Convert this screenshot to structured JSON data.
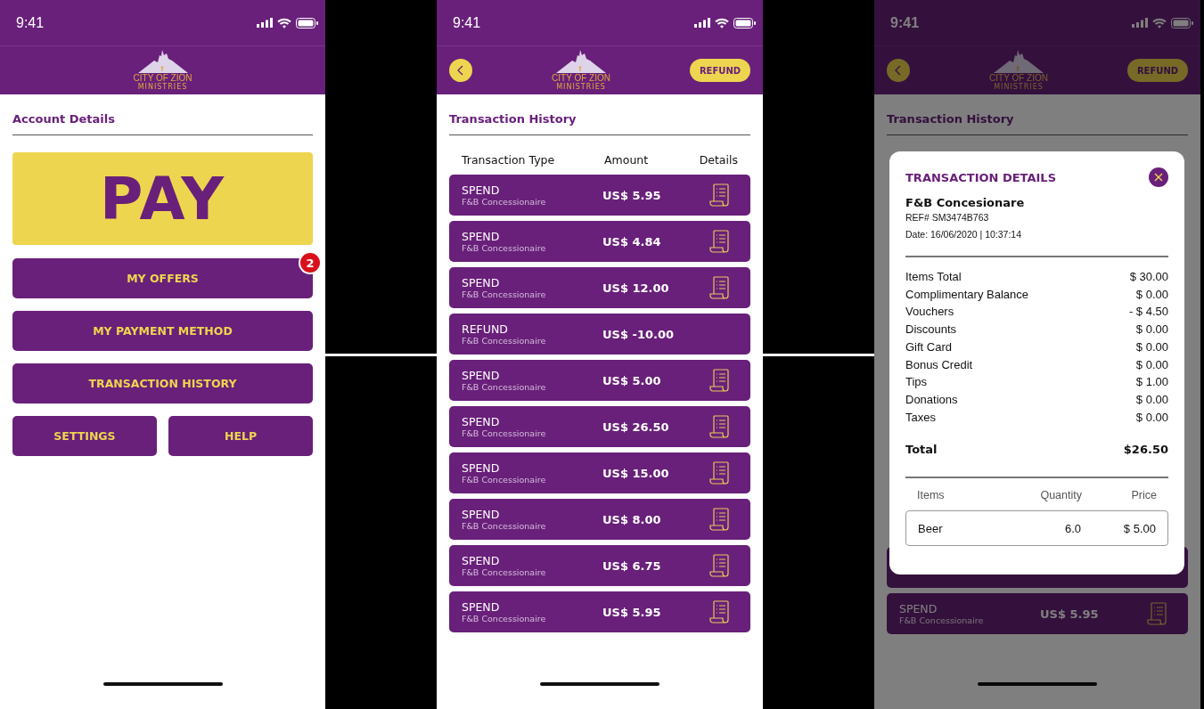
{
  "account_screen": {
    "time": "9:41",
    "logo": {
      "name": "CITY OF ZION",
      "subtitle": "MINISTRIES"
    },
    "title": "Account Details",
    "pay_button": "PAY",
    "buttons": [
      {
        "label": "MY OFFERS",
        "kind": "full",
        "badge": "2"
      },
      {
        "label": "MY PAYMENT METHOD",
        "kind": "full"
      },
      {
        "label": "TRANSACTION HISTORY",
        "kind": "full"
      },
      {
        "label": "SETTINGS",
        "kind": "half"
      },
      {
        "label": "HELP",
        "kind": "half"
      }
    ]
  },
  "history_screen": {
    "time": "9:41",
    "logo": {
      "name": "CITY OF ZION",
      "subtitle": "MINISTRIES"
    },
    "refund_button": "REFUND",
    "title": "Transaction History",
    "columns": [
      "Transaction Type",
      "Amount",
      "Details"
    ],
    "rows": [
      {
        "type": "SPEND",
        "merchant": "F&B Concessionaire",
        "amount": "US$ 5.95",
        "receipt": true
      },
      {
        "type": "SPEND",
        "merchant": "F&B Concessionaire",
        "amount": "US$ 4.84",
        "receipt": true
      },
      {
        "type": "SPEND",
        "merchant": "F&B Concessionaire",
        "amount": "US$ 12.00",
        "receipt": true
      },
      {
        "type": "REFUND",
        "merchant": "F&B Concessionaire",
        "amount": "US$ -10.00",
        "receipt": false
      },
      {
        "type": "SPEND",
        "merchant": "F&B Concessionaire",
        "amount": "US$ 5.00",
        "receipt": true
      },
      {
        "type": "SPEND",
        "merchant": "F&B Concessionaire",
        "amount": "US$ 26.50",
        "receipt": true
      },
      {
        "type": "SPEND",
        "merchant": "F&B Concessionaire",
        "amount": "US$ 15.00",
        "receipt": true
      },
      {
        "type": "SPEND",
        "merchant": "F&B Concessionaire",
        "amount": "US$ 8.00",
        "receipt": true
      },
      {
        "type": "SPEND",
        "merchant": "F&B Concessionaire",
        "amount": "US$ 6.75",
        "receipt": true
      },
      {
        "type": "SPEND",
        "merchant": "F&B Concessionaire",
        "amount": "US$ 5.95",
        "receipt": true
      }
    ]
  },
  "details_screen": {
    "time": "9:41",
    "logo": {
      "name": "CITY OF ZION",
      "subtitle": "MINISTRIES"
    },
    "refund_button": "REFUND",
    "title": "Transaction History",
    "rows": [
      {
        "type": "SPEND",
        "merchant": "F&B Concessionaire",
        "amount": "US$ 5.95",
        "receipt": true
      }
    ],
    "modal": {
      "title": "TRANSACTION DETAILS",
      "merchant": "F&B Concesionare",
      "ref": "REF# SM3474B763",
      "date": "Date: 16/06/2020 | 10:37:14",
      "lines": [
        {
          "label": "Items Total",
          "value": "$ 30.00"
        },
        {
          "label": "Complimentary Balance",
          "value": "$ 0.00"
        },
        {
          "label": "Vouchers",
          "value": "- $ 4.50"
        },
        {
          "label": "Discounts",
          "value": "$ 0.00"
        },
        {
          "label": "Gift Card",
          "value": "$ 0.00"
        },
        {
          "label": "Bonus Credit",
          "value": "$ 0.00"
        },
        {
          "label": "Tips",
          "value": "$ 1.00"
        },
        {
          "label": "Donations",
          "value": "$ 0.00"
        },
        {
          "label": "Taxes",
          "value": "$ 0.00"
        }
      ],
      "total": {
        "label": "Total",
        "value": "$26.50"
      },
      "item_columns": [
        "Items",
        "Quantity",
        "Price"
      ],
      "items": [
        {
          "name": "Beer",
          "quantity": "6.0",
          "price": "$ 5.00"
        }
      ]
    }
  }
}
